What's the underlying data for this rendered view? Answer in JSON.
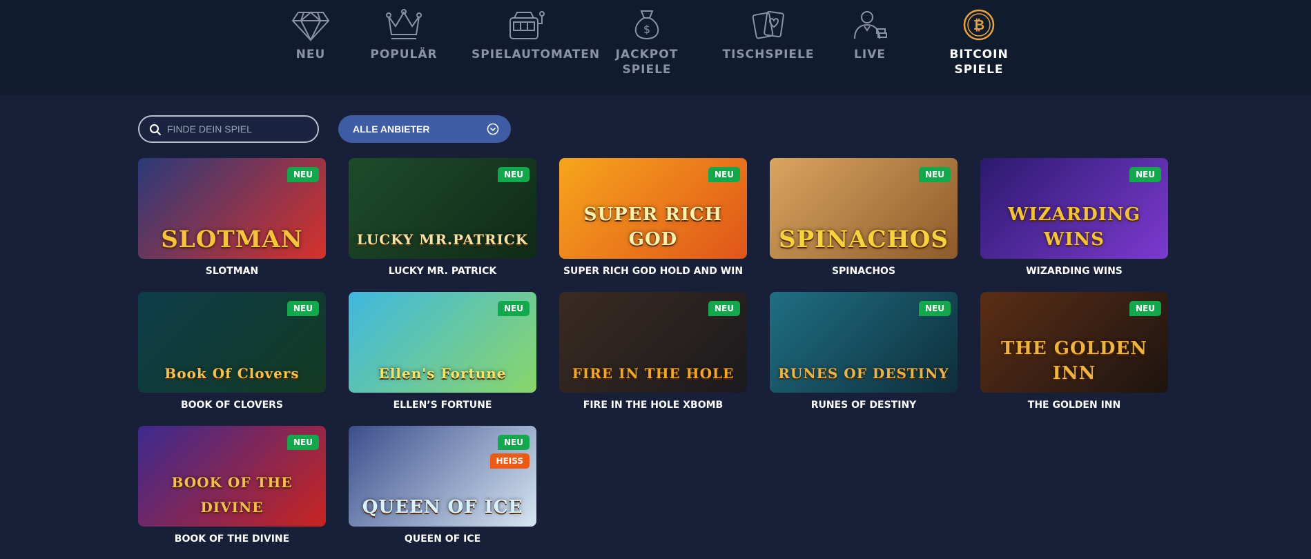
{
  "nav": [
    {
      "id": "neu",
      "label": "NEU",
      "icon": "diamond-icon",
      "active": false
    },
    {
      "id": "popular",
      "label": "POPULÄR",
      "icon": "crown-icon",
      "active": false
    },
    {
      "id": "slots",
      "label": "SPIELAUTOMATEN",
      "icon": "slot-machine-icon",
      "active": false
    },
    {
      "id": "jackpot",
      "label": "JACKPOT SPIELE",
      "icon": "money-bag-icon",
      "active": false
    },
    {
      "id": "table",
      "label": "TISCHSPIELE",
      "icon": "cards-icon",
      "active": false
    },
    {
      "id": "live",
      "label": "LIVE",
      "icon": "dealer-icon",
      "active": false
    },
    {
      "id": "bitcoin",
      "label": "BITCOIN SPIELE",
      "icon": "bitcoin-icon",
      "active": true
    }
  ],
  "search": {
    "placeholder": "FINDE DEIN SPIEL",
    "value": "",
    "icon": "search-icon"
  },
  "provider_filter": {
    "selected": "ALLE ANBIETER",
    "icon": "chevron-down-circle-icon"
  },
  "badges": {
    "neu": "NEU",
    "heiss": "HEISS"
  },
  "games": [
    {
      "title": "SLOTMAN",
      "logo": "SLOTMAN",
      "badges": [
        "NEU"
      ],
      "colors": [
        "#2a3a7a",
        "#d8312a"
      ],
      "logo_color": "#f6c33b"
    },
    {
      "title": "LUCKY MR. PATRICK",
      "logo": "LUCKY MR.PATRICK",
      "badges": [
        "NEU"
      ],
      "colors": [
        "#1f4b2a",
        "#0f2a18"
      ],
      "logo_color": "#f1e3a6"
    },
    {
      "title": "SUPER RICH GOD HOLD AND WIN",
      "logo": "SUPER RICH GOD",
      "badges": [
        "NEU"
      ],
      "colors": [
        "#f7a51c",
        "#e0551a"
      ],
      "logo_color": "#fff3b0"
    },
    {
      "title": "SPINACHOS",
      "logo": "SPINACHOS",
      "badges": [
        "NEU"
      ],
      "colors": [
        "#d9a560",
        "#8d5a2b"
      ],
      "logo_color": "#f7d23a"
    },
    {
      "title": "WIZARDING WINS",
      "logo": "WIZARDING WINS",
      "badges": [
        "NEU"
      ],
      "colors": [
        "#2b1a6e",
        "#7d3ad0"
      ],
      "logo_color": "#f5c433"
    },
    {
      "title": "BOOK OF CLOVERS",
      "logo": "Book Of Clovers",
      "badges": [
        "NEU"
      ],
      "colors": [
        "#0c3c4a",
        "#143a22"
      ],
      "logo_color": "#f3c447"
    },
    {
      "title": "ELLEN’S FORTUNE",
      "logo": "Ellen's Fortune",
      "badges": [
        "NEU"
      ],
      "colors": [
        "#3fb8e0",
        "#8ad66a"
      ],
      "logo_color": "#f2e66a"
    },
    {
      "title": "FIRE IN THE HOLE XBOMB",
      "logo": "FIRE IN THE HOLE",
      "badges": [
        "NEU"
      ],
      "colors": [
        "#3a2b22",
        "#1b1a1e"
      ],
      "logo_color": "#f6a81d"
    },
    {
      "title": "RUNES OF DESTINY",
      "logo": "RUNES OF DESTINY",
      "badges": [
        "NEU"
      ],
      "colors": [
        "#1f6f82",
        "#0e2e3b"
      ],
      "logo_color": "#e8b54a"
    },
    {
      "title": "THE GOLDEN INN",
      "logo": "THE GOLDEN INN",
      "badges": [
        "NEU"
      ],
      "colors": [
        "#5a2e16",
        "#1d1410"
      ],
      "logo_color": "#f0b43a"
    },
    {
      "title": "BOOK OF THE DIVINE",
      "logo": "BOOK OF THE DIVINE",
      "badges": [
        "NEU"
      ],
      "colors": [
        "#3b2a8f",
        "#c9241f"
      ],
      "logo_color": "#f4c04a"
    },
    {
      "title": "QUEEN OF ICE",
      "logo": "QUEEN OF ICE",
      "badges": [
        "NEU",
        "HEISS"
      ],
      "colors": [
        "#3b4e8c",
        "#d6e6f2"
      ],
      "logo_color": "#d8f3ff"
    }
  ]
}
